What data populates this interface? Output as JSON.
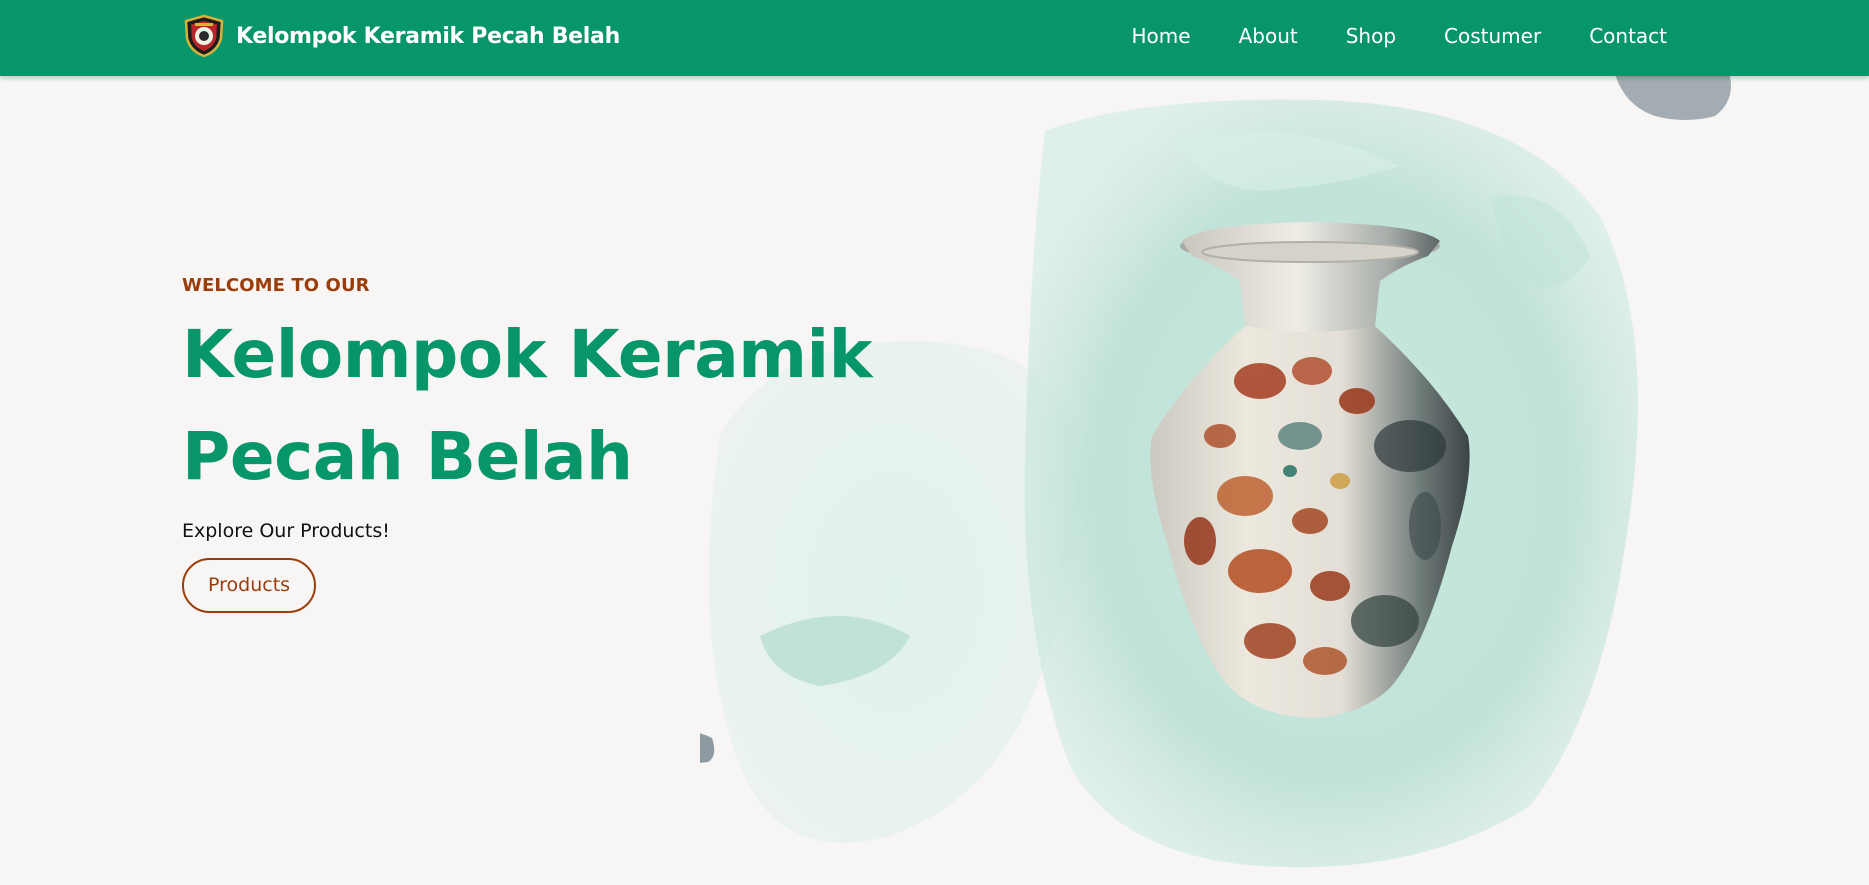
{
  "navbar": {
    "brand_name": "Kelompok Keramik Pecah Belah",
    "logo_icon": "shield-emblem-logo",
    "links": [
      {
        "label": "Home"
      },
      {
        "label": "About"
      },
      {
        "label": "Shop"
      },
      {
        "label": "Costumer"
      },
      {
        "label": "Contact"
      }
    ]
  },
  "hero": {
    "eyebrow": "WELCOME TO OUR",
    "title_line1": "Kelompok Keramik",
    "title_line2": "Pecah Belah",
    "subtitle": "Explore Our Products!",
    "button_label": "Products",
    "image": "ceramic-vase-illustration"
  },
  "colors": {
    "primary_green": "#07966a",
    "accent_brown": "#9a3d0b",
    "background": "#f7f6f4",
    "watercolor_mint": "#bfe3d8",
    "splash_gray": "#8e9aa2"
  }
}
